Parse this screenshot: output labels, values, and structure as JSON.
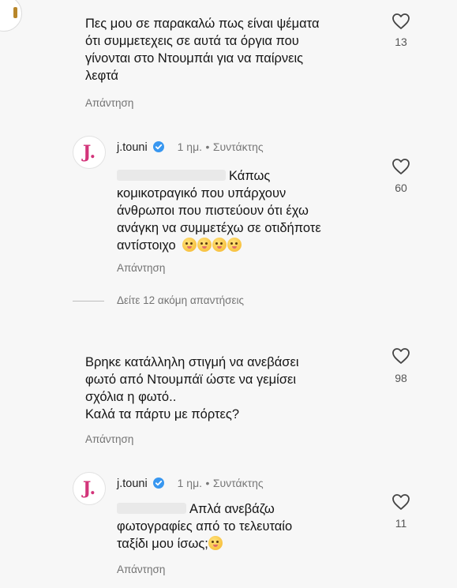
{
  "comments": [
    {
      "text_lines": [
        "Πες μου σε παρακαλώ πως είναι ψέματα",
        "ότι συμμετεχεις σε αυτά τα όργια που",
        "γίνονται στο Ντουμπάι για να παίρνεις",
        "λεφτά"
      ],
      "reply_label": "Απάντηση",
      "likes": "13"
    },
    {
      "username": "j.touni",
      "time": "1 ημ.",
      "role": "Συντάκτης",
      "text_lines": [
        "Κάπως",
        "κομικοτραγικό που υπάρχουν",
        "άνθρωποι που πιστεύουν ότι έχω",
        "ανάγκη να συμμετέχω σε οτιδήποτε",
        "αντίστοιχο"
      ],
      "reply_label": "Απάντηση",
      "likes": "60"
    },
    {
      "text_lines": [
        "Βρηκε κατάλληλη στιγμή να ανεβάσει",
        "φωτό από Ντουμπάϊ ώστε να γεμίσει",
        "σχόλια η φωτό..",
        "Καλά τα πάρτυ με πόρτες?"
      ],
      "reply_label": "Απάντηση",
      "likes": "98"
    },
    {
      "username": "j.touni",
      "time": "1 ημ.",
      "role": "Συντάκτης",
      "text_lines": [
        "Απλά ανεβάζω",
        "φωτογραφίες από το τελευταίο",
        "ταξίδι μου ίσως;"
      ],
      "reply_label": "Απάντηση",
      "likes": "11"
    }
  ],
  "view_more_replies": "Δείτε 12 ακόμη απαντήσεις",
  "separator": "•",
  "avatar_letter": "J.",
  "colors": {
    "avatar_letter": "#d3347a",
    "verified": "#3897f0",
    "muted": "#737373"
  },
  "icons": [
    "heart-icon",
    "verified-badge-icon",
    "emoji-icon"
  ]
}
